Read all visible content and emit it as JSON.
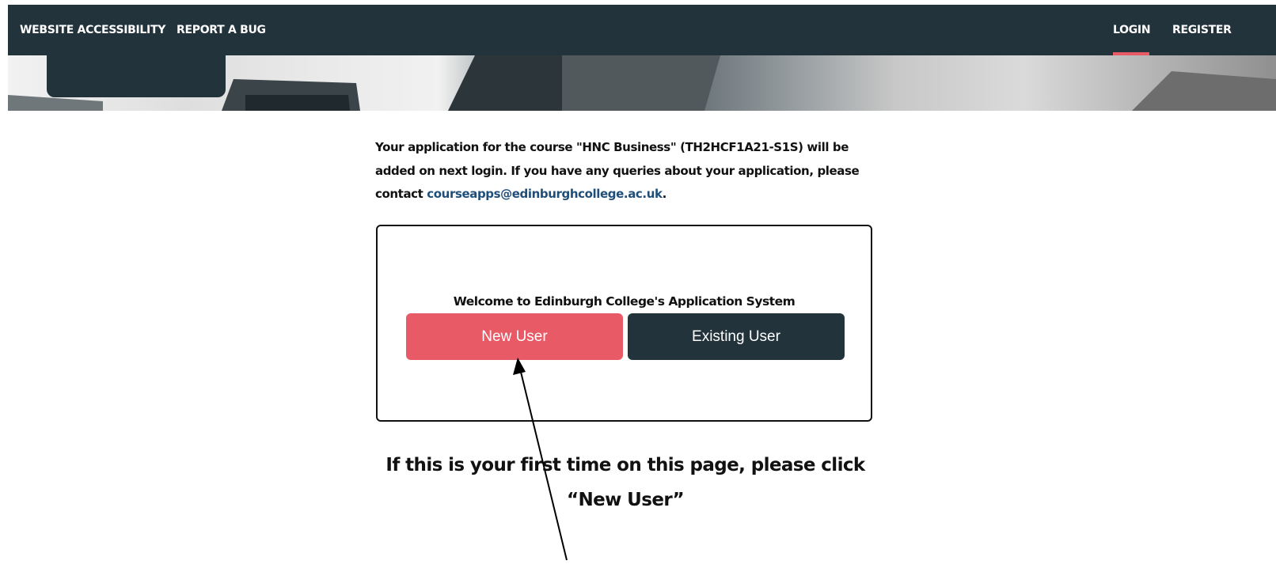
{
  "nav": {
    "left_links": [
      "WEBSITE ACCESSIBILITY",
      "REPORT A BUG"
    ],
    "right_links": [
      "LOGIN",
      "REGISTER"
    ],
    "active": "LOGIN",
    "accent_color": "#e85a66",
    "bar_color": "#22333b"
  },
  "intro": {
    "text_before": "Your application for the course \"HNC Business\" (TH2HCF1A21-S1S) will be added on next login. If you have any queries about your application, please contact ",
    "email": "courseapps@edinburghcollege.ac.uk",
    "text_after": "."
  },
  "welcome": {
    "title": "Welcome to Edinburgh College's Application System",
    "new_user_label": "New User",
    "existing_user_label": "Existing User",
    "new_user_color": "#e85a66",
    "existing_user_color": "#22333b"
  },
  "instruction": {
    "line1": "If this is your first time on this page, please click",
    "line2": "“New User”"
  },
  "annotation": {
    "icon": "arrow-icon"
  }
}
